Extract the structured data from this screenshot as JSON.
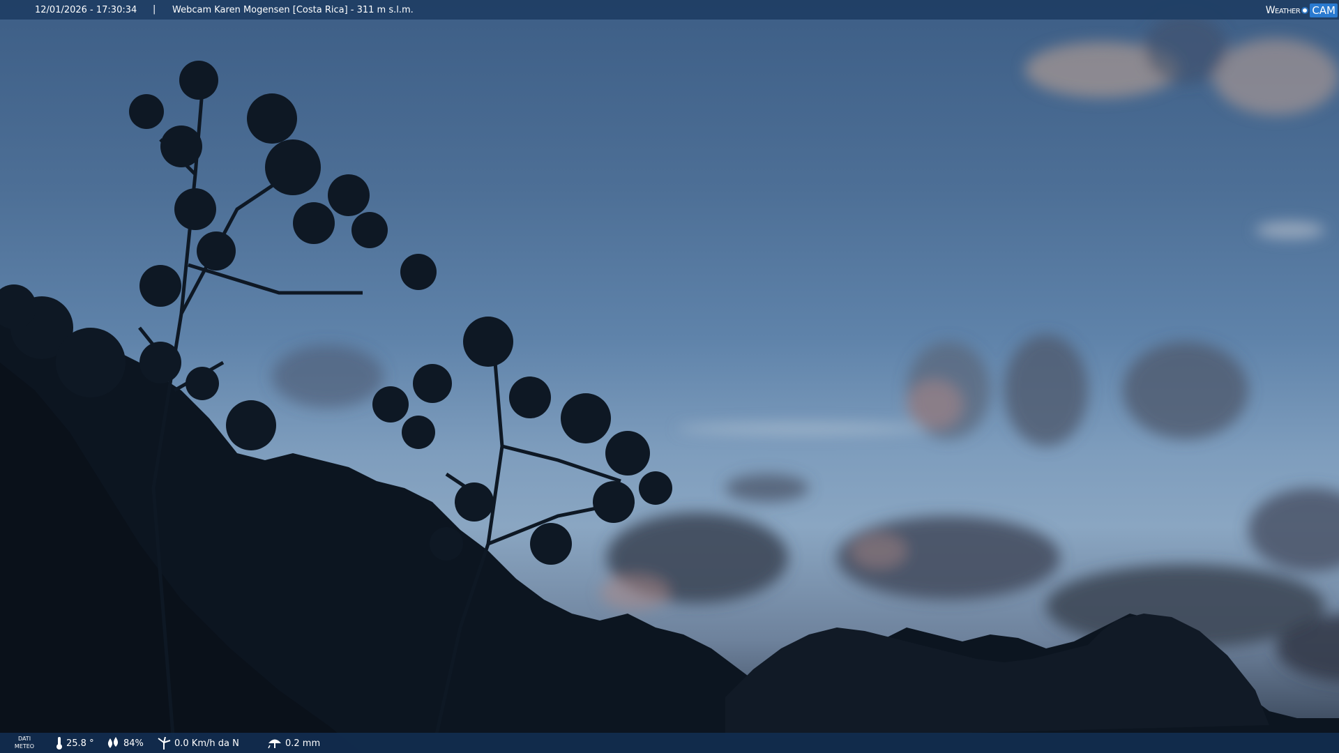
{
  "header": {
    "datetime": "12/01/2026 - 17:30:34",
    "separator": "|",
    "title": "Webcam Karen Mogensen [Costa Rica] - 311 m s.l.m."
  },
  "brand": {
    "weather": "Weather",
    "cam": "CAM"
  },
  "weather_data": {
    "label_line1": "DATI",
    "label_line2": "METEO",
    "temperature": "25.8 °",
    "humidity": "84%",
    "wind": "0.0 Km/h da N",
    "rain": "0.2 mm"
  },
  "icons": {
    "temperature": "thermometer-icon",
    "humidity": "humidity-drops-icon",
    "wind": "wind-turbine-icon",
    "rain": "rain-umbrella-icon"
  },
  "colors": {
    "top_bar": "#1e3e64",
    "bottom_bar": "#122c4e",
    "brand_accent": "#2a7ad0",
    "sky_top": "#3d5e86",
    "sky_mid": "#7e9dbd",
    "foliage": "#0c1622"
  }
}
